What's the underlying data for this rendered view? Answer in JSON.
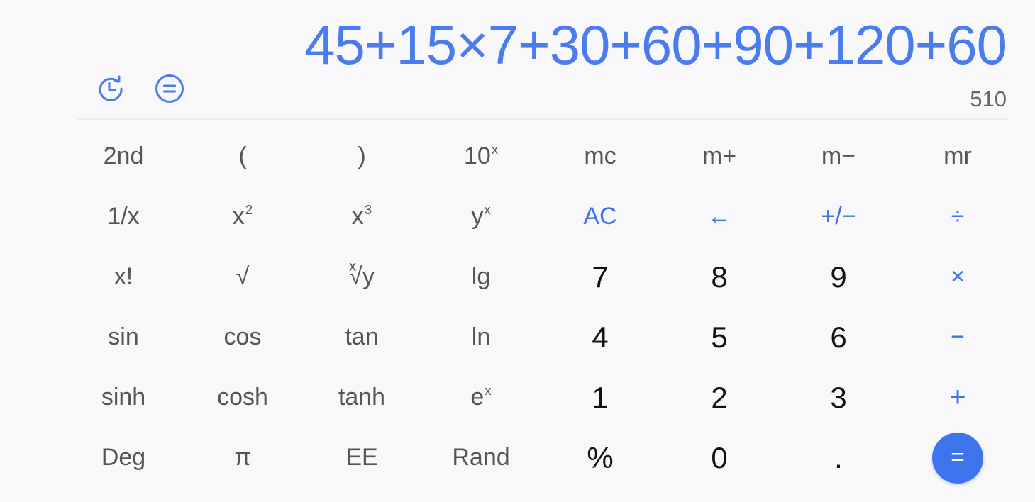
{
  "display": {
    "expression": "45+15×7+30+60+90+120+60",
    "result": "510"
  },
  "icons": {
    "history": "history-icon",
    "menu": "menu-equals-icon"
  },
  "colors": {
    "accent": "#3d73ec",
    "function_text": "#555555",
    "number_text": "#111111",
    "background": "#f8f8fb"
  },
  "keys": {
    "second": "2nd",
    "lparen": "(",
    "rparen": ")",
    "ten_pow_base": "10",
    "ten_pow_exp": "x",
    "mc": "mc",
    "mplus": "m+",
    "mminus": "m−",
    "mr": "mr",
    "reciprocal": "1/x",
    "square_base": "x",
    "square_exp": "2",
    "cube_base": "x",
    "cube_exp": "3",
    "ypow_base": "y",
    "ypow_exp": "x",
    "ac": "AC",
    "backspace": "←",
    "sign": "+/−",
    "divide": "÷",
    "factorial": "x!",
    "sqrt": "√",
    "root_index": "x",
    "root_body": "√y",
    "lg": "lg",
    "seven": "7",
    "eight": "8",
    "nine": "9",
    "multiply": "×",
    "sin": "sin",
    "cos": "cos",
    "tan": "tan",
    "ln": "ln",
    "four": "4",
    "five": "5",
    "six": "6",
    "minus": "−",
    "sinh": "sinh",
    "cosh": "cosh",
    "tanh": "tanh",
    "epow_base": "e",
    "epow_exp": "x",
    "one": "1",
    "two": "2",
    "three": "3",
    "plus": "+",
    "deg": "Deg",
    "pi": "π",
    "ee": "EE",
    "rand": "Rand",
    "percent": "%",
    "zero": "0",
    "dot": ".",
    "equals": "="
  }
}
